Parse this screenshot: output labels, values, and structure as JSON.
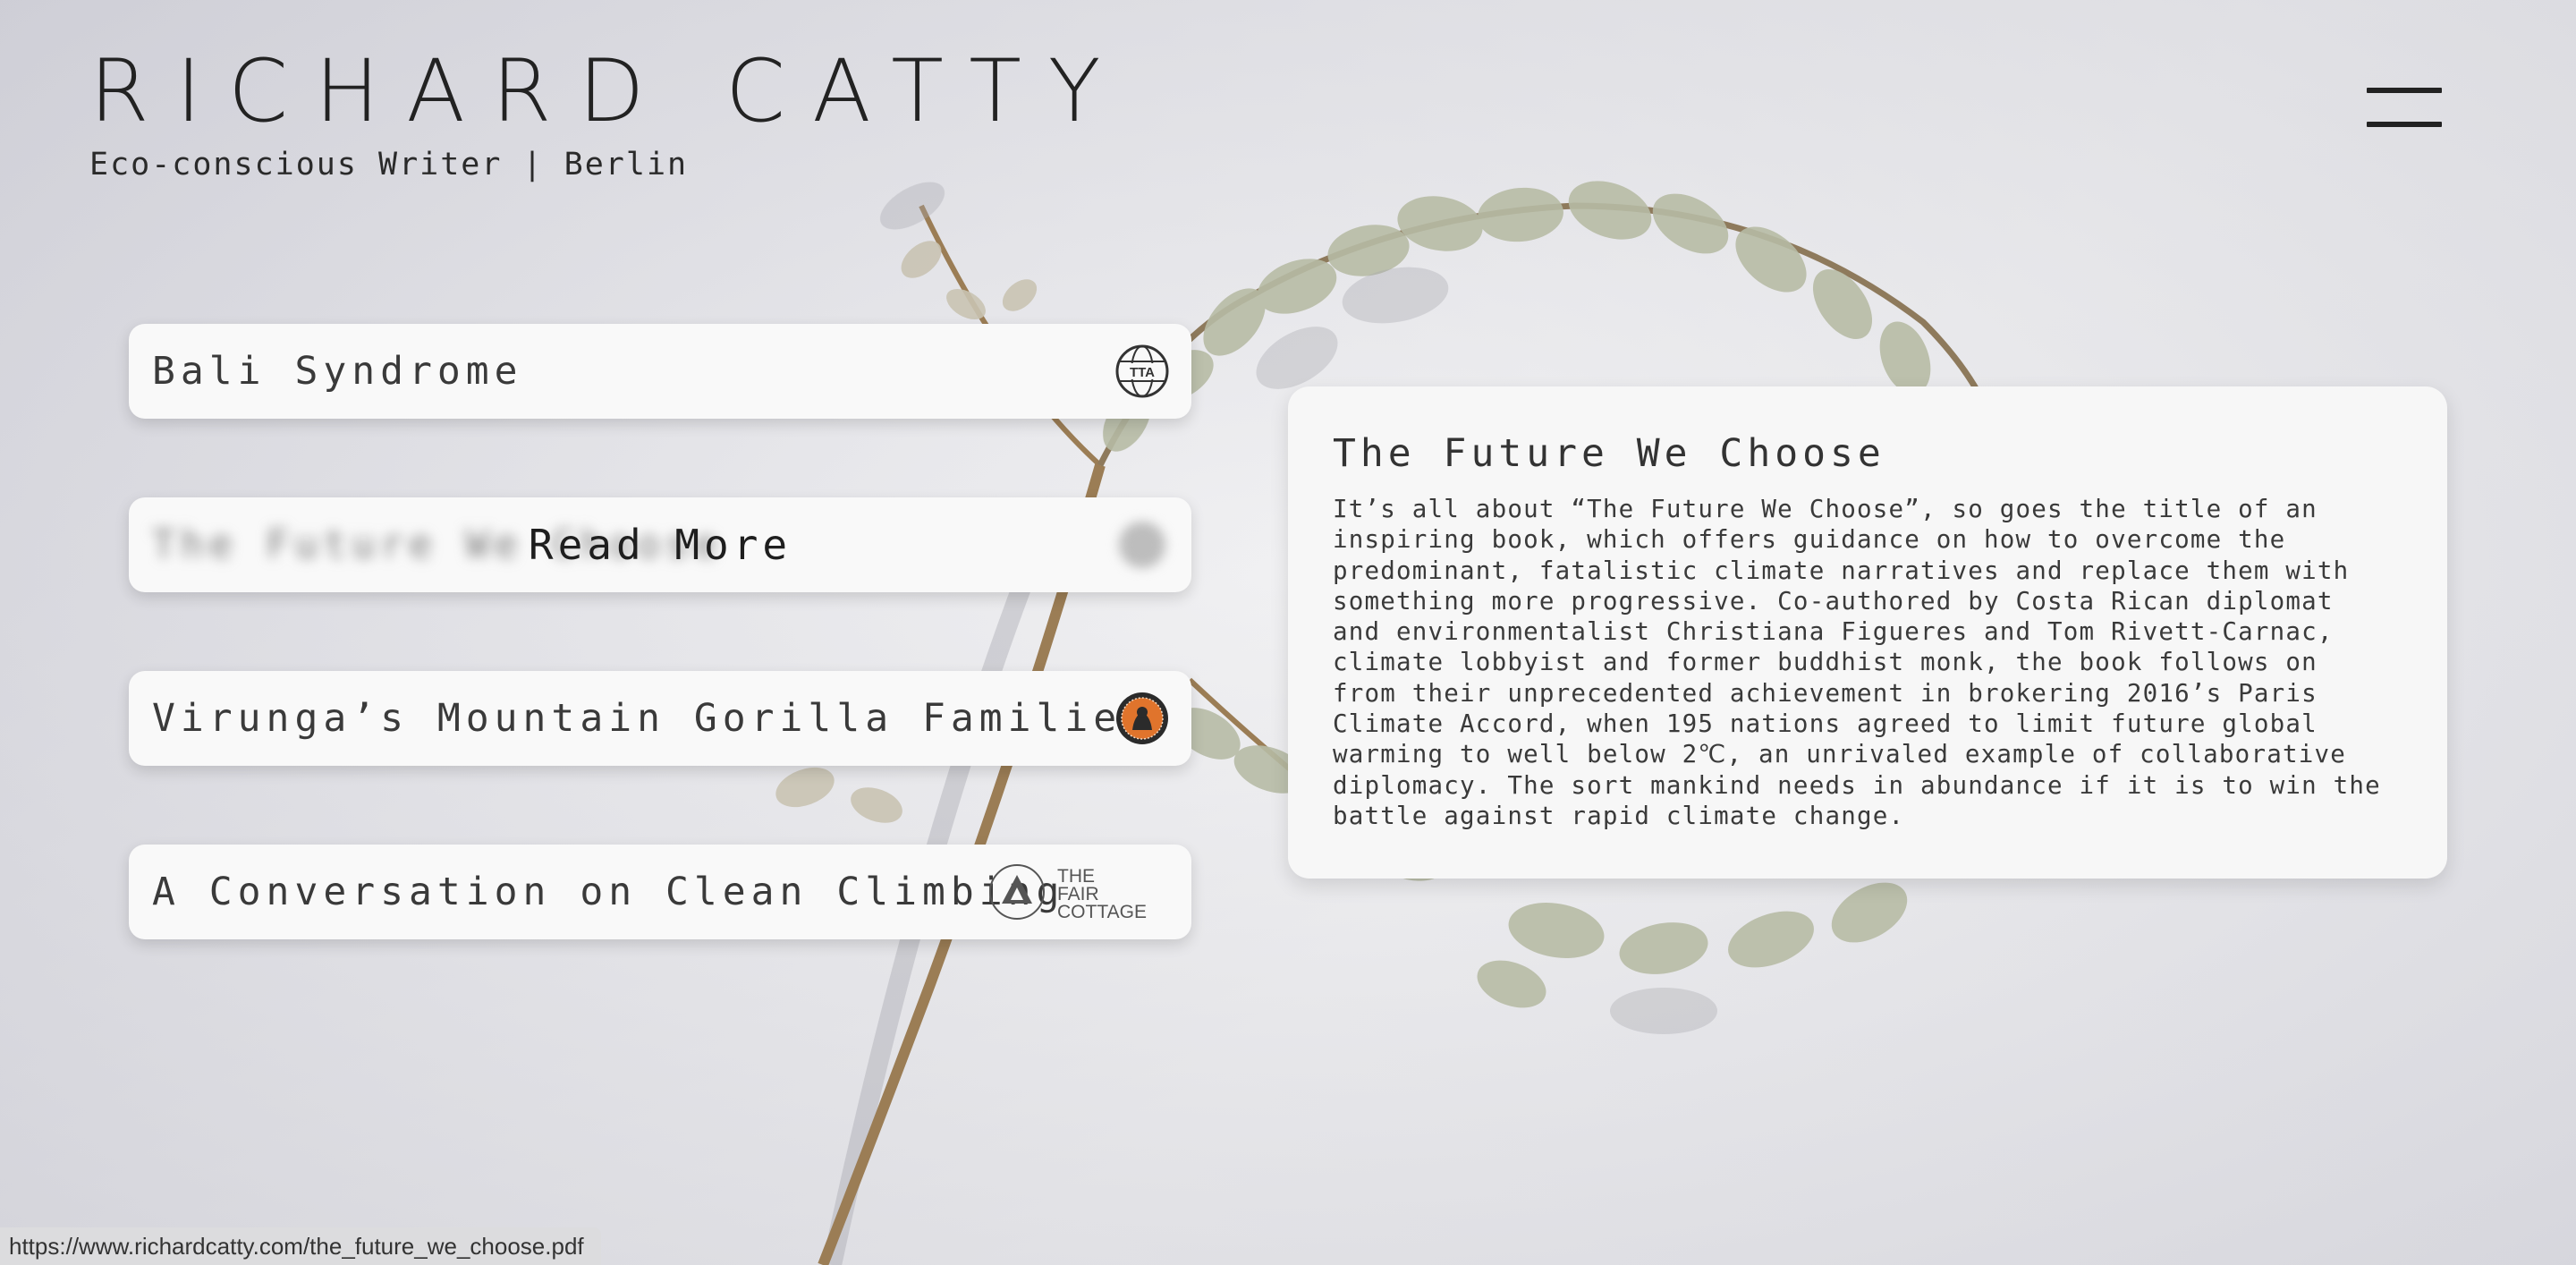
{
  "site": {
    "title": "RICHARD CATTY",
    "subtitle": "Eco-conscious Writer | Berlin"
  },
  "menu": {
    "icon": "hamburger-menu-icon"
  },
  "articles": [
    {
      "label": "Bali Syndrome",
      "logo": "tta-globe-logo",
      "logo_text": "TTA"
    },
    {
      "label": "The Future We Choose",
      "logo": "circle-logo",
      "overlay": "Read More"
    },
    {
      "label": "Virunga’s Mountain Gorilla Families",
      "logo": "gorilla-badge-logo"
    },
    {
      "label": "A Conversation on Clean Climbing",
      "logo": "the-fair-cottage-logo",
      "logo_text": [
        "THE",
        "FAIR",
        "COTTAGE"
      ]
    }
  ],
  "detail": {
    "title": "The Future We Choose",
    "lines": [
      "It’s all about “The Future We Choose”, so goes the title of an",
      "inspiring book, which offers guidance on how to overcome the",
      "predominant, fatalistic climate narratives and replace them with",
      "something more progressive. Co-authored by Costa Rican diplomat",
      "and environmentalist Christiana Figueres and Tom Rivett-Carnac,",
      "climate lobbyist and former buddhist monk, the book follows on",
      "from their unprecedented achievement in brokering 2016’s Paris",
      "Climate Accord, when 195 nations agreed to limit future global",
      "warming to well below 2℃, an unrivaled example of collaborative",
      "diplomacy. The sort mankind needs in abundance if it is to win the",
      "battle against rapid climate change."
    ]
  },
  "status_bar": {
    "url": "https://www.richardcatty.com/the_future_we_choose.pdf"
  }
}
